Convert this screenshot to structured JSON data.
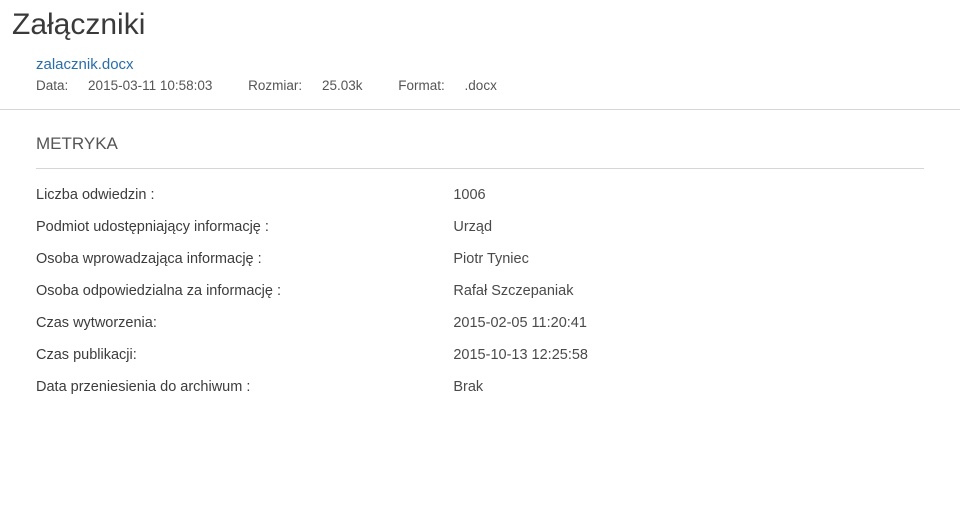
{
  "page": {
    "title": "Załączniki"
  },
  "attachment": {
    "filename": "zalacznik.docx",
    "date_label": "Data:",
    "date_value": "2015-03-11 10:58:03",
    "size_label": "Rozmiar:",
    "size_value": "25.03k",
    "format_label": "Format:",
    "format_value": ".docx"
  },
  "metryka": {
    "heading": "METRYKA",
    "rows": [
      {
        "label": "Liczba odwiedzin :",
        "value": "1006"
      },
      {
        "label": "Podmiot udostępniający informację :",
        "value": "Urząd"
      },
      {
        "label": "Osoba wprowadzająca informację :",
        "value": "Piotr Tyniec"
      },
      {
        "label": "Osoba odpowiedzialna za informację :",
        "value": "Rafał Szczepaniak"
      },
      {
        "label": "Czas wytworzenia:",
        "value": "2015-02-05 11:20:41"
      },
      {
        "label": "Czas publikacji:",
        "value": "2015-10-13 12:25:58"
      },
      {
        "label": "Data przeniesienia do archiwum :",
        "value": "Brak"
      }
    ]
  }
}
